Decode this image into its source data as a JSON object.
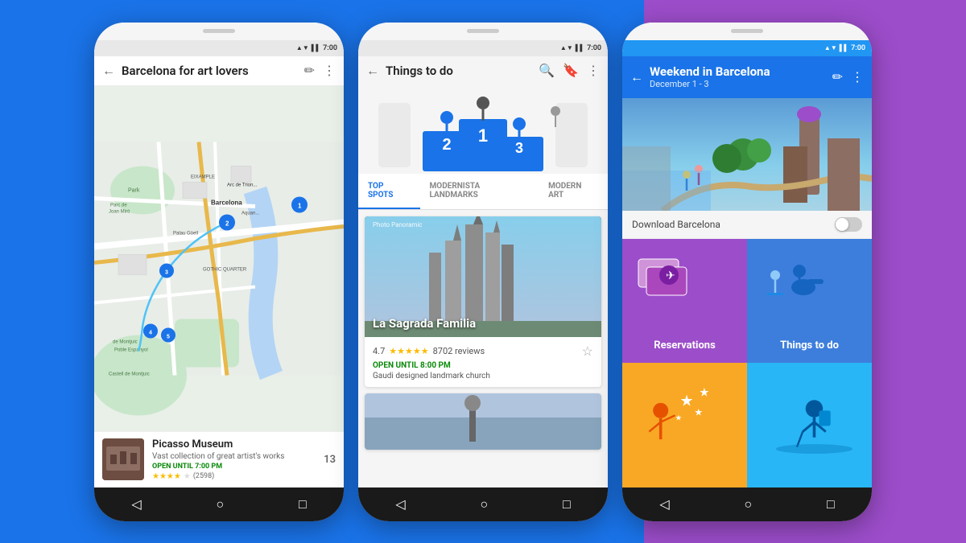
{
  "backgrounds": {
    "left": "#1a73e8",
    "middle": "#1a73e8",
    "right": "#9c4dca"
  },
  "phone1": {
    "status": {
      "time": "7:00",
      "wifi": "▲▼",
      "signal": "▌▌▌"
    },
    "header": {
      "back_label": "←",
      "title": "Barcelona for art lovers",
      "edit_icon": "✏",
      "more_icon": "⋮"
    },
    "card": {
      "name": "Picasso Museum",
      "description": "Vast collection of great artist's works",
      "open_label": "OPEN UNTIL 7:00 PM",
      "rating": "4.2",
      "review_count": "(2598)",
      "number": "13"
    },
    "nav": {
      "back": "◁",
      "home": "○",
      "recent": "□"
    }
  },
  "phone2": {
    "status": {
      "time": "7:00"
    },
    "header": {
      "back_label": "←",
      "title": "Things to do",
      "search_icon": "🔍",
      "bookmark_icon": "🔖",
      "more_icon": "⋮"
    },
    "tabs": [
      {
        "label": "TOP SPOTS",
        "active": true
      },
      {
        "label": "MODERNISTA LANDMARKS",
        "active": false
      },
      {
        "label": "MODERN ART",
        "active": false
      }
    ],
    "spot": {
      "photo_label": "Photo Panoramic",
      "name": "La Sagrada Familia",
      "rating": "4.7",
      "reviews": "8702 reviews",
      "open_label": "OPEN UNTIL 8:00 PM",
      "description": "Gaudi designed landmark church"
    },
    "nav": {
      "back": "◁",
      "home": "○",
      "recent": "□"
    }
  },
  "phone3": {
    "status": {
      "time": "7:00"
    },
    "header": {
      "back_label": "←",
      "title": "Weekend in Barcelona",
      "subtitle": "December 1 - 3",
      "edit_icon": "✏",
      "more_icon": "⋮"
    },
    "download_label": "Download Barcelona",
    "cards": [
      {
        "label": "Reservations",
        "bg": "#9c4dca",
        "key": "reservations"
      },
      {
        "label": "Things to do",
        "bg": "#3d7edc",
        "key": "things-to-do"
      },
      {
        "label": "",
        "bg": "#f9a825",
        "key": "food"
      },
      {
        "label": "",
        "bg": "#29b6f6",
        "key": "explore"
      }
    ],
    "nav": {
      "back": "◁",
      "home": "○",
      "recent": "□"
    }
  }
}
